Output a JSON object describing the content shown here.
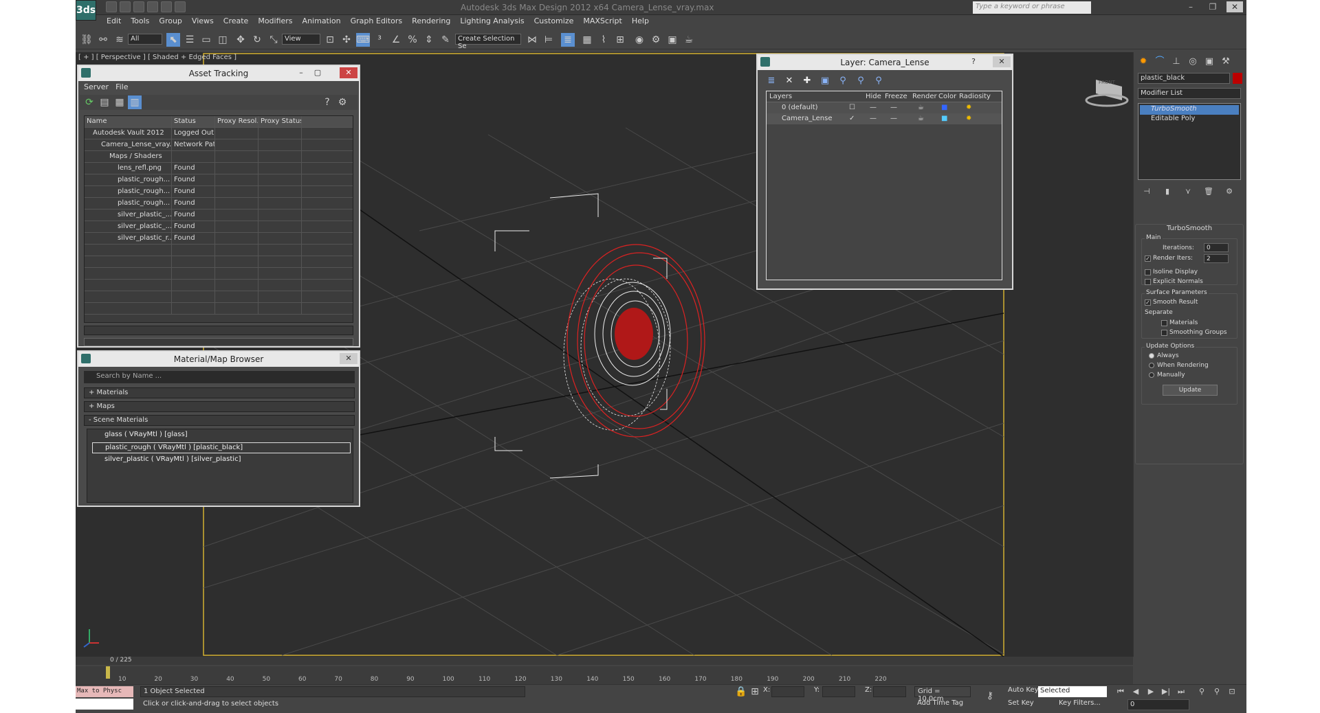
{
  "app": {
    "logo": "3ds",
    "title": "Autodesk 3ds Max Design 2012 x64     Camera_Lense_vray.max",
    "search_placeholder": "Type a keyword or phrase"
  },
  "menu": [
    "Edit",
    "Tools",
    "Group",
    "Views",
    "Create",
    "Modifiers",
    "Animation",
    "Graph Editors",
    "Rendering",
    "Lighting Analysis",
    "Customize",
    "MAXScript",
    "Help"
  ],
  "toolbar": {
    "filter": "All",
    "refcoord": "View",
    "named_sel": "Create Selection Se"
  },
  "viewport": {
    "label": "[ + ] [ Perspective ] [ Shaded + Edged Faces ]",
    "viewcube": "FRONT"
  },
  "asset_tracking": {
    "title": "Asset Tracking",
    "menu": [
      "Server",
      "File"
    ],
    "columns": [
      "Name",
      "Status",
      "Proxy Resol...",
      "Proxy Status"
    ],
    "rows": [
      {
        "name": "Autodesk Vault 2012",
        "status": "Logged Out ...",
        "indent": 1
      },
      {
        "name": "Camera_Lense_vray....",
        "status": "Network Path",
        "indent": 2
      },
      {
        "name": "Maps / Shaders",
        "status": "",
        "indent": 3
      },
      {
        "name": "lens_refl.png",
        "status": "Found",
        "indent": 4
      },
      {
        "name": "plastic_rough...",
        "status": "Found",
        "indent": 4
      },
      {
        "name": "plastic_rough...",
        "status": "Found",
        "indent": 4
      },
      {
        "name": "plastic_rough...",
        "status": "Found",
        "indent": 4
      },
      {
        "name": "silver_plastic_...",
        "status": "Found",
        "indent": 4
      },
      {
        "name": "silver_plastic_...",
        "status": "Found",
        "indent": 4
      },
      {
        "name": "silver_plastic_r...",
        "status": "Found",
        "indent": 4
      }
    ]
  },
  "material_browser": {
    "title": "Material/Map Browser",
    "search": "Search by Name ...",
    "sections": [
      "+ Materials",
      "+ Maps",
      "- Scene Materials"
    ],
    "items": [
      "glass  ( VRayMtl ) [glass]",
      "plastic_rough  ( VRayMtl ) [plastic_black]",
      "silver_plastic  ( VRayMtl ) [silver_plastic]"
    ]
  },
  "layer_dialog": {
    "title": "Layer: Camera_Lense",
    "columns": [
      "Layers",
      "Hide",
      "Freeze",
      "Render",
      "Color",
      "Radiosity"
    ],
    "rows": [
      {
        "name": "0 (default)",
        "active": "☐"
      },
      {
        "name": "Camera_Lense",
        "active": "✓"
      }
    ]
  },
  "command_panel": {
    "object_name": "plastic_black",
    "modifier_list": "Modifier List",
    "stack": [
      "TurboSmooth",
      "Editable Poly"
    ],
    "turbosmooth": {
      "title": "TurboSmooth",
      "main": "Main",
      "iterations_label": "Iterations:",
      "iterations": "0",
      "render_iters_label": "Render Iters:",
      "render_iters": "2",
      "isoline": "Isoline Display",
      "explicit": "Explicit Normals",
      "surface": "Surface Parameters",
      "smooth_result": "Smooth Result",
      "separate": "Separate",
      "materials": "Materials",
      "smoothing_groups": "Smoothing Groups",
      "update_options": "Update Options",
      "always": "Always",
      "when_rendering": "When Rendering",
      "manually": "Manually",
      "update_btn": "Update"
    }
  },
  "timeline": {
    "slider": "0 / 225",
    "ticks": [
      "10",
      "20",
      "30",
      "40",
      "50",
      "60",
      "70",
      "80",
      "90",
      "100",
      "110",
      "120",
      "130",
      "140",
      "150",
      "160",
      "170",
      "180",
      "190",
      "200",
      "210",
      "220"
    ]
  },
  "status": {
    "maxscript": "Max to Physc",
    "selected": "1 Object Selected",
    "prompt": "Click or click-and-drag to select objects",
    "x": "X:",
    "y": "Y:",
    "z": "Z:",
    "grid": "Grid = 10,0cm",
    "add_time_tag": "Add Time Tag",
    "auto_key": "Auto Key",
    "set_key": "Set Key",
    "selected_dropdown": "Selected",
    "key_filters": "Key Filters...",
    "frame": "0"
  }
}
